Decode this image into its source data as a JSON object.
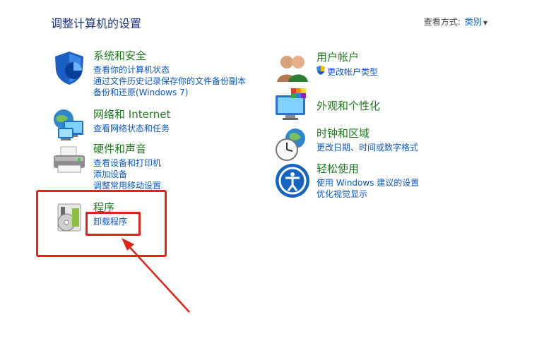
{
  "header": {
    "title": "调整计算机的设置",
    "view_by_label": "查看方式:",
    "view_by_value": "类别"
  },
  "categories": [
    {
      "title": "系统和安全",
      "links": [
        "查看你的计算机状态",
        "通过文件历史记录保存你的文件备份副本",
        "备份和还原(Windows 7)"
      ],
      "icon": "shield-icon"
    },
    {
      "title": "网络和 Internet",
      "links": [
        "查看网络状态和任务"
      ],
      "icon": "network-globe-icon"
    },
    {
      "title": "硬件和声音",
      "links": [
        "查看设备和打印机",
        "添加设备",
        "调整常用移动设置"
      ],
      "icon": "printer-icon"
    },
    {
      "title": "程序",
      "links": [
        "卸载程序"
      ],
      "icon": "programs-disc-icon"
    },
    {
      "title": "用户帐户",
      "links": [
        "更改帐户类型"
      ],
      "icon": "users-icon"
    },
    {
      "title": "外观和个性化",
      "links": [],
      "icon": "monitor-palette-icon"
    },
    {
      "title": "时钟和区域",
      "links": [
        "更改日期、时间或数字格式"
      ],
      "icon": "clock-globe-icon"
    },
    {
      "title": "轻松使用",
      "links": [
        "使用 Windows 建议的设置",
        "优化视觉显示"
      ],
      "icon": "ease-of-access-icon"
    }
  ],
  "colors": {
    "heading": "#1e7a1e",
    "link": "#0b57d0",
    "title": "#1e3287",
    "highlight": "#e2231a"
  }
}
